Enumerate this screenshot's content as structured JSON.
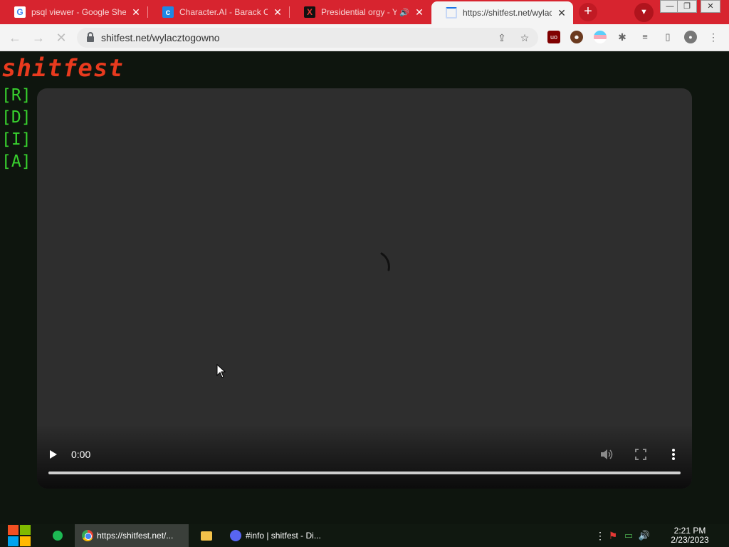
{
  "browser": {
    "tabs": [
      {
        "title": "psql viewer - Google Sheets",
        "favicon": "google-g-icon"
      },
      {
        "title": "Character.AI - Barack Obama",
        "favicon": "character-ai-icon"
      },
      {
        "title": "Presidential orgy - YouTube",
        "favicon": "x-icon",
        "audio": true
      },
      {
        "title": "https://shitfest.net/wylacztogowno",
        "favicon": "loading-spinner-icon",
        "active": true
      }
    ],
    "new_tab_label": "+",
    "window_controls": [
      "minimize",
      "restore",
      "close"
    ],
    "url": "shitfest.net/wylacztogowno",
    "accent_color": "#d7242f"
  },
  "page": {
    "logo": "shitfest",
    "nav": [
      "[R]",
      "[D]",
      "[I]",
      "[A]"
    ],
    "logo_color": "#e83a1e",
    "nav_color": "#38d12e",
    "video": {
      "time": "0:00",
      "progress": 0
    }
  },
  "taskbar": {
    "items": [
      {
        "label": "https://shitfest.net/...",
        "icon": "chrome-icon",
        "active": true
      },
      {
        "label": "#info | shitfest - Di...",
        "icon": "discord-icon",
        "active": false
      }
    ],
    "clock_time": "2:21 PM",
    "clock_date": "2/23/2023"
  }
}
